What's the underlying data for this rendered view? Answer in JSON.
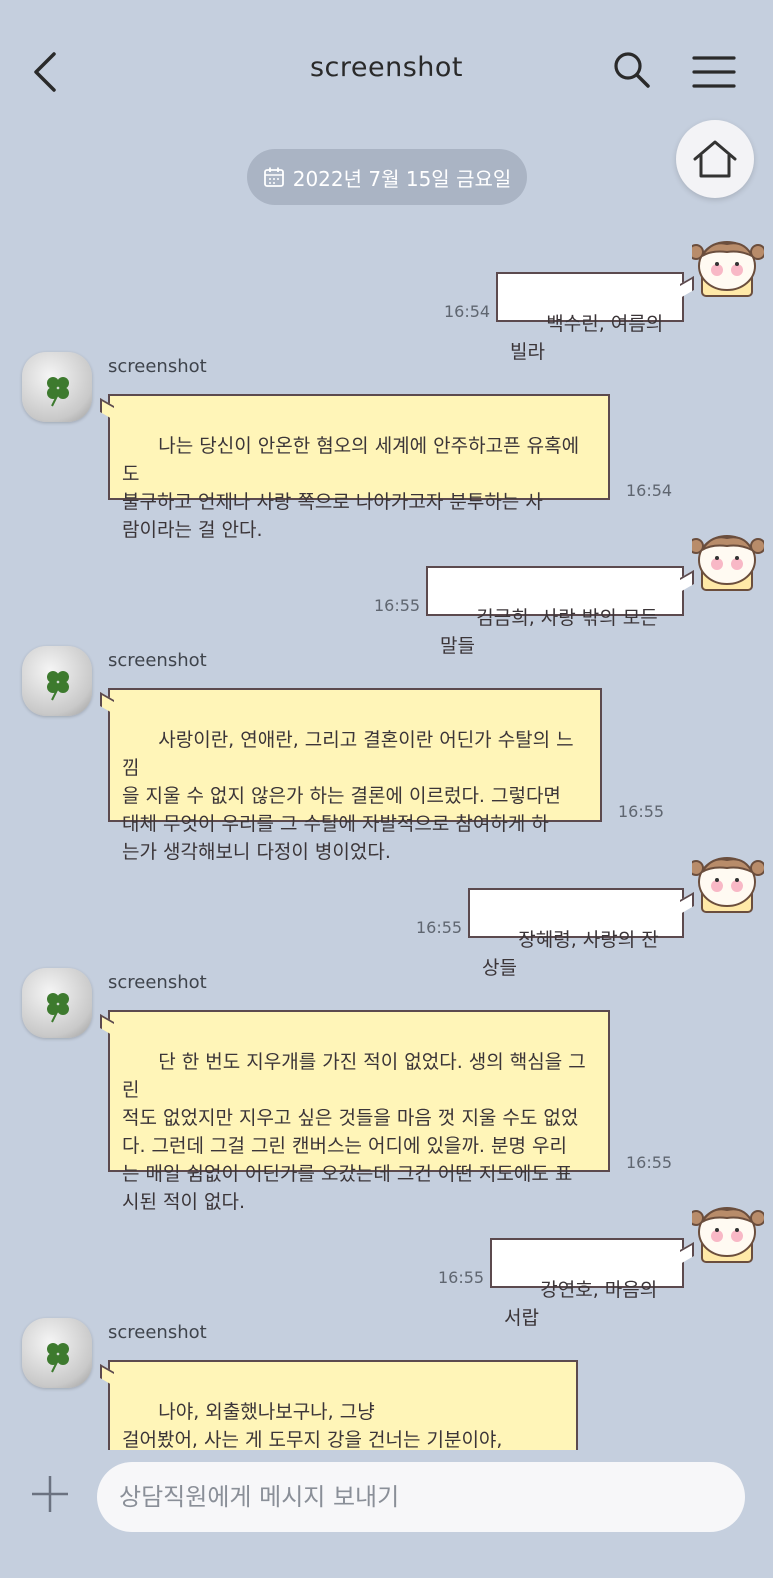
{
  "header": {
    "title": "screenshot",
    "back_icon": "chevron-left-icon",
    "search_icon": "search-icon",
    "menu_icon": "hamburger-menu-icon",
    "home_icon": "home-icon"
  },
  "date_divider": {
    "icon": "calendar-icon",
    "label": "2022년 7월 15일 금요일"
  },
  "messages": [
    {
      "type": "sent",
      "text": "백수린, 여름의 빌라",
      "time": "16:54"
    },
    {
      "type": "received",
      "sender": "screenshot",
      "text": "나는 당신이 안온한 혐오의 세계에 안주하고픈 유혹에도\n불구하고 언제나 사랑 쪽으로 나아가고자 분투하는 사\n람이라는 걸 안다.",
      "time": "16:54"
    },
    {
      "type": "sent",
      "text": "김금희, 사랑 밖의 모든 말들",
      "time": "16:55"
    },
    {
      "type": "received",
      "sender": "screenshot",
      "text": "사랑이란, 연애란, 그리고 결혼이란 어딘가 수탈의 느낌\n을 지울 수 없지 않은가 하는 결론에 이르렀다. 그렇다면\n대체 무엇이 우리를 그 수탈에 자발적으로 참여하게 하\n는가 생각해보니 다정이 병이었다.",
      "time": "16:55"
    },
    {
      "type": "sent",
      "text": "장혜령, 사랑의 잔상들",
      "time": "16:55"
    },
    {
      "type": "received",
      "sender": "screenshot",
      "text": "단 한 번도 지우개를 가진 적이 없었다. 생의 핵심을 그린\n적도 없었지만 지우고 싶은 것들을 마음 껏 지울 수도 없었\n다. 그런데 그걸 그린 캔버스는 어디에 있을까. 분명 우리\n는 매일 쉼없이 어딘가를 오갔는데 그건 어떤 지도에도 표\n시된 적이 없다.",
      "time": "16:55"
    },
    {
      "type": "sent",
      "text": "강연호, 마음의 서랍",
      "time": "16:55"
    },
    {
      "type": "received",
      "sender": "screenshot",
      "text": "나야, 외출했나보구나, 그냥\n걸어봤어, 사는 게 도무지 강을 건너는 기분이야,\n한여름이 되돌아오는 시호음에 대고 혼자 주얼거리듯",
      "time": ""
    }
  ],
  "composer": {
    "plus_icon": "plus-icon",
    "placeholder": "상담직원에게 메시지 보내기"
  },
  "colors": {
    "background": "#c5cfde",
    "sent_bubble": "#ffffff",
    "received_bubble": "#fff5b8",
    "bubble_border": "#5c4a4e",
    "date_pill": "#aab4c4"
  }
}
